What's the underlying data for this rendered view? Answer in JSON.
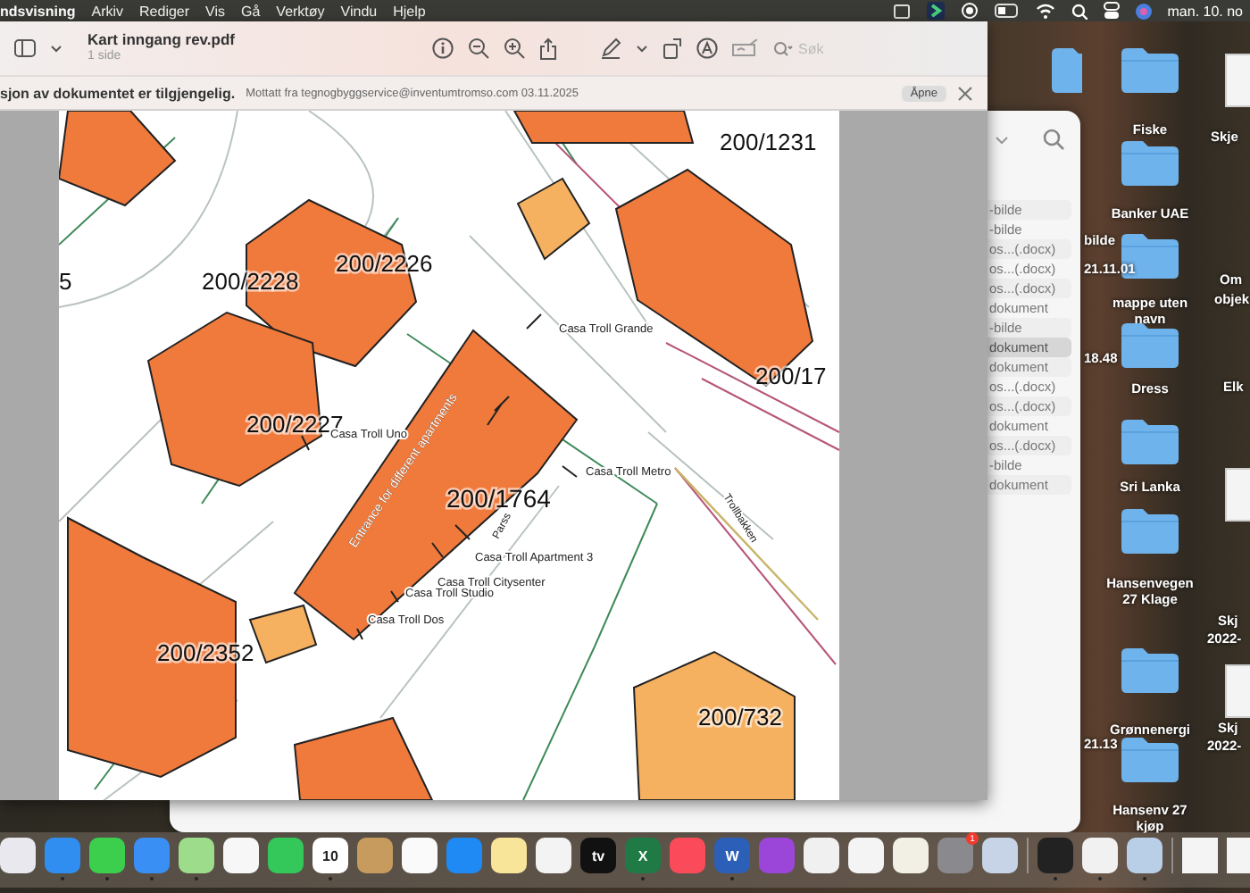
{
  "menubar": {
    "app": "ndsvisning",
    "menus": [
      "Arkiv",
      "Rediger",
      "Vis",
      "Gå",
      "Verktøy",
      "Vindu",
      "Hjelp"
    ],
    "clock": "man. 10. no"
  },
  "preview": {
    "title": "Kart inngang rev.pdf",
    "subtitle": "1 side",
    "search": {
      "placeholder": "Søk"
    },
    "banner": {
      "message": "sjon av dokumentet er tilgjengelig.",
      "detail": "Mottatt fra tegnogbyggservice@inventumtromso.com 03.11.2025",
      "button": "Åpne"
    }
  },
  "map": {
    "parcels": [
      "200/1231",
      "200/2228",
      "200/2226",
      "200/2227",
      "200/1764",
      "200/2352",
      "200/732",
      "200/17",
      "5"
    ],
    "annotations": [
      "Casa Troll Grande",
      "Casa Troll Uno",
      "Casa Troll Metro",
      "Casa Troll Apartment 3",
      "Casa Troll Citysenter",
      "Casa Troll Studio",
      "Casa Troll Dos"
    ],
    "entrance": "Entrance for different apartments",
    "parking": "Parss",
    "road": "Trollbakken"
  },
  "finder": {
    "rows": [
      {
        "label": "-bilde",
        "selected": false
      },
      {
        "label": "-bilde",
        "selected": false
      },
      {
        "label": "os...(.docx)",
        "selected": false
      },
      {
        "label": "os...(.docx)",
        "selected": false
      },
      {
        "label": "os...(.docx)",
        "selected": false
      },
      {
        "label": "dokument",
        "selected": false
      },
      {
        "label": "-bilde",
        "selected": false
      },
      {
        "label": "dokument",
        "selected": true
      },
      {
        "label": "dokument",
        "selected": false
      },
      {
        "label": "os...(.docx)",
        "selected": false
      },
      {
        "label": "os...(.docx)",
        "selected": false
      },
      {
        "label": "dokument",
        "selected": false
      },
      {
        "label": "os...(.docx)",
        "selected": false
      },
      {
        "label": "-bilde",
        "selected": false
      },
      {
        "label": "dokument",
        "selected": false
      }
    ]
  },
  "desktop": {
    "folders": [
      "Fiske",
      "Banker UAE",
      "mappe uten navn",
      "Dress",
      "Sri Lanka",
      "Hansenvegen 27 Klage",
      "Grønnenergi",
      "Hansenv 27 kjøp"
    ],
    "side_labels": [
      "Skje",
      "Om",
      "objek",
      "Elk",
      "Skj",
      "2022-",
      "Skj",
      "2022-"
    ],
    "file_labels": [
      "bilde",
      "21.11.01",
      "18.48",
      "21.13"
    ]
  },
  "dock": {
    "items": [
      {
        "kind": "launchpad",
        "running": false
      },
      {
        "kind": "safari",
        "running": true
      },
      {
        "kind": "messages",
        "running": true
      },
      {
        "kind": "mail",
        "running": true
      },
      {
        "kind": "maps",
        "running": true
      },
      {
        "kind": "photos",
        "running": false
      },
      {
        "kind": "facetime",
        "running": false
      },
      {
        "kind": "calendar",
        "running": true,
        "label": "10"
      },
      {
        "kind": "contacts",
        "running": false
      },
      {
        "kind": "reminders",
        "running": false
      },
      {
        "kind": "appstore",
        "running": false
      },
      {
        "kind": "notes",
        "running": false
      },
      {
        "kind": "freeform",
        "running": false
      },
      {
        "kind": "tv",
        "running": false,
        "label": "tv"
      },
      {
        "kind": "excel",
        "running": true,
        "label": "X"
      },
      {
        "kind": "music",
        "running": false
      },
      {
        "kind": "word",
        "running": true,
        "label": "W"
      },
      {
        "kind": "podcasts",
        "running": false
      },
      {
        "kind": "keynote",
        "running": false
      },
      {
        "kind": "numbers",
        "running": false
      },
      {
        "kind": "pages",
        "running": false
      },
      {
        "kind": "settings",
        "running": false,
        "badge": "1"
      },
      {
        "kind": "mirroring",
        "running": false
      },
      {
        "kind": "terminal",
        "running": true
      },
      {
        "kind": "chrome",
        "running": true
      },
      {
        "kind": "preview",
        "running": true
      }
    ]
  }
}
